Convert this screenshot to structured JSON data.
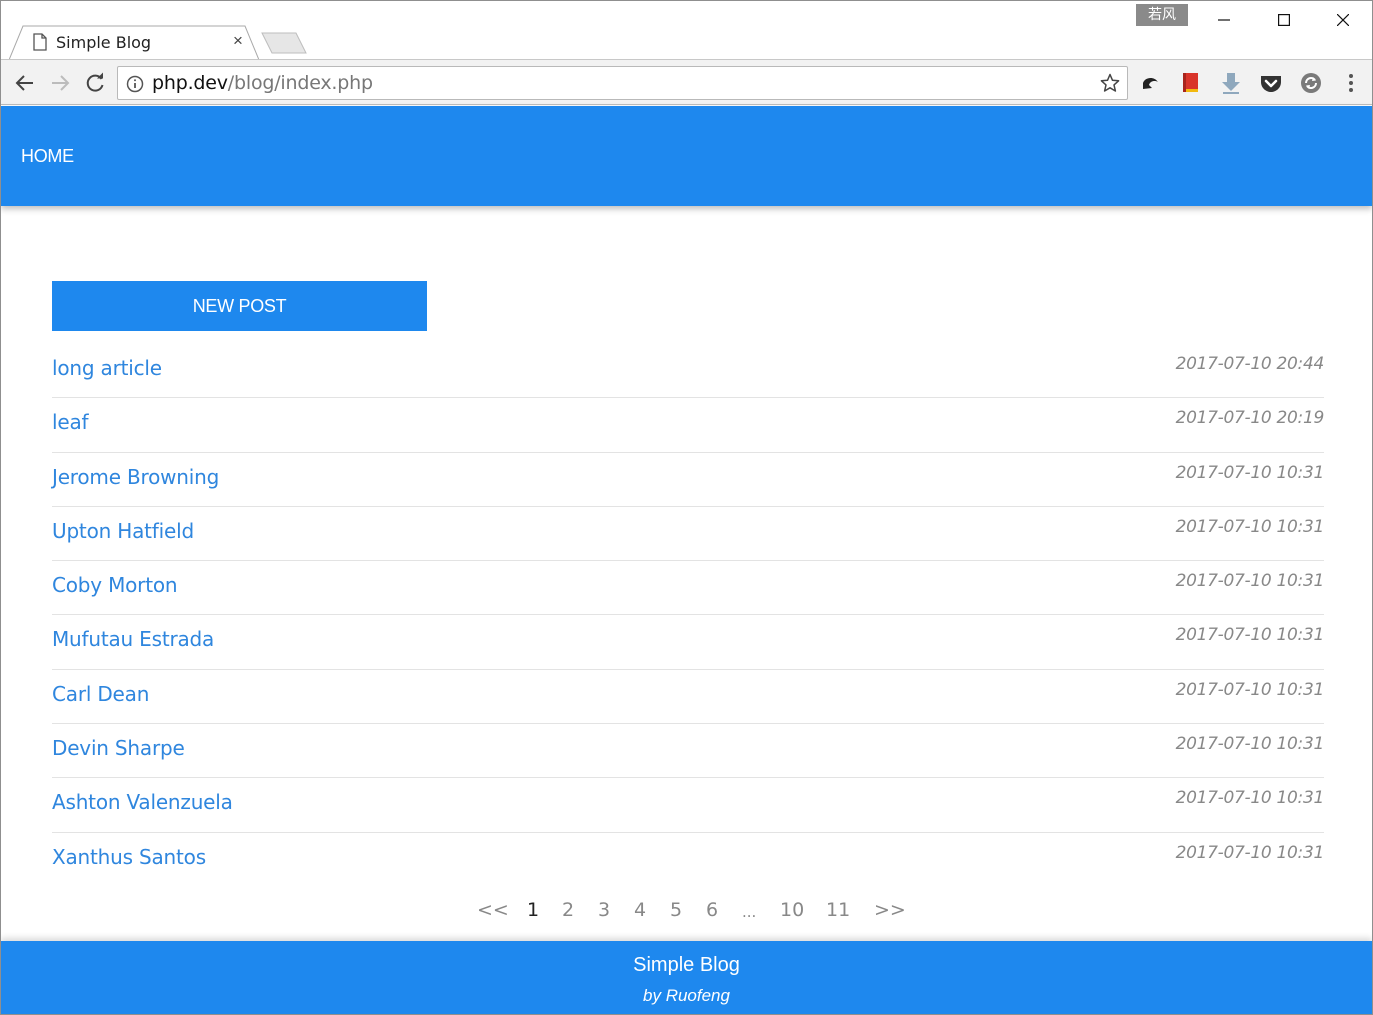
{
  "browser": {
    "tab_title": "Simple Blog",
    "tab_close": "×",
    "ime_label": "若风",
    "url_host": "php.dev",
    "url_path": "/blog/index.php"
  },
  "nav": {
    "home": "HOME"
  },
  "new_post_label": "NEW POST",
  "posts": [
    {
      "title": "long article",
      "time": "2017-07-10 20:44"
    },
    {
      "title": "leaf",
      "time": "2017-07-10 20:19"
    },
    {
      "title": "Jerome Browning",
      "time": "2017-07-10 10:31"
    },
    {
      "title": "Upton Hatfield",
      "time": "2017-07-10 10:31"
    },
    {
      "title": "Coby Morton",
      "time": "2017-07-10 10:31"
    },
    {
      "title": "Mufutau Estrada",
      "time": "2017-07-10 10:31"
    },
    {
      "title": "Carl Dean",
      "time": "2017-07-10 10:31"
    },
    {
      "title": "Devin Sharpe",
      "time": "2017-07-10 10:31"
    },
    {
      "title": "Ashton Valenzuela",
      "time": "2017-07-10 10:31"
    },
    {
      "title": "Xanthus Santos",
      "time": "2017-07-10 10:31"
    }
  ],
  "pagination": {
    "prev": "<<",
    "pages": [
      "1",
      "2",
      "3",
      "4",
      "5",
      "6",
      "...",
      "10",
      "11"
    ],
    "current": "1",
    "next": ">>"
  },
  "footer": {
    "title": "Simple Blog",
    "byline": "by Ruofeng"
  },
  "colors": {
    "brand": "#1e88ee",
    "link": "#2f86de",
    "timestamp": "#888888"
  },
  "icons": [
    "page-icon",
    "close-icon",
    "minimize-icon",
    "maximize-icon",
    "window-close-icon",
    "back-icon",
    "forward-icon",
    "reload-icon",
    "info-icon",
    "star-icon",
    "undo-extension-icon",
    "bookmark-extension-icon",
    "download-extension-icon",
    "pocket-extension-icon",
    "sync-extension-icon",
    "menu-icon"
  ]
}
